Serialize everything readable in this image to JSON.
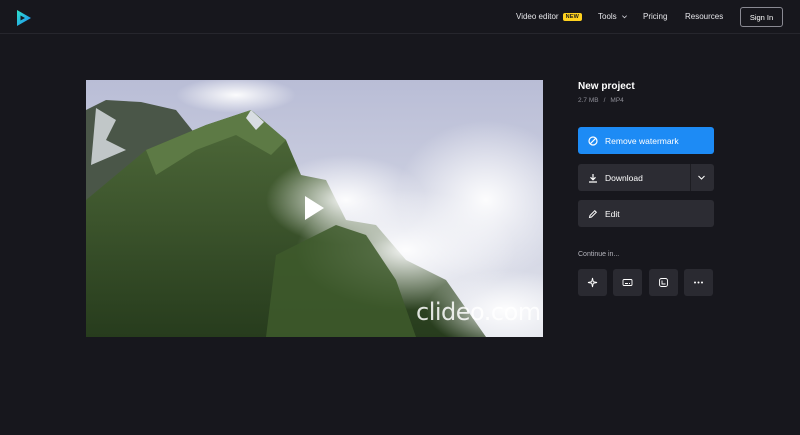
{
  "header": {
    "nav": {
      "video_editor": "Video editor",
      "new_badge": "NEW",
      "tools": "Tools",
      "pricing": "Pricing",
      "resources": "Resources"
    },
    "sign_in": "Sign In"
  },
  "video": {
    "watermark": "clideo.com"
  },
  "project": {
    "title": "New project",
    "size": "2.7 MB",
    "separator": "/",
    "format": "MP4"
  },
  "actions": {
    "remove_watermark": "Remove watermark",
    "download": "Download",
    "edit": "Edit"
  },
  "continue": {
    "label": "Continue in...",
    "tools": [
      "sparkle-icon",
      "subtitles-icon",
      "crop-icon",
      "more-icon"
    ]
  },
  "colors": {
    "background": "#17171d",
    "accent": "#1d8bf5",
    "badge": "#ffd21f",
    "button": "#2c2c33"
  }
}
